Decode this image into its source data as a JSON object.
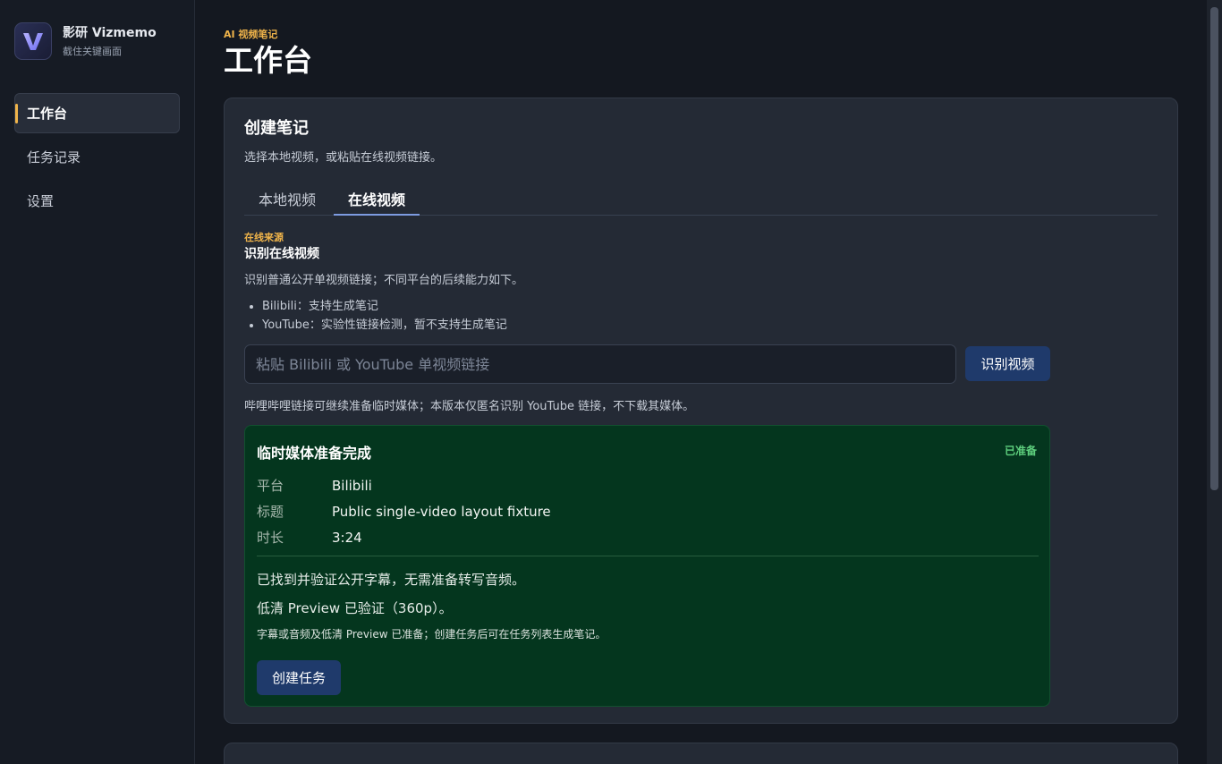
{
  "brand": {
    "name": "影研 Vizmemo",
    "tagline": "截住关键画面",
    "logo_icon": "v-logo-icon"
  },
  "sidebar": {
    "items": [
      {
        "label": "工作台",
        "active": true
      },
      {
        "label": "任务记录",
        "active": false
      },
      {
        "label": "设置",
        "active": false
      }
    ]
  },
  "header": {
    "eyebrow": "AI 视频笔记",
    "title": "工作台"
  },
  "card": {
    "title": "创建笔记",
    "subtitle": "选择本地视频，或粘贴在线视频链接。",
    "tabs": [
      {
        "label": "本地视频",
        "active": false
      },
      {
        "label": "在线视频",
        "active": true
      }
    ]
  },
  "online": {
    "eyebrow": "在线来源",
    "title": "识别在线视频",
    "description": "识别普通公开单视频链接；不同平台的后续能力如下。",
    "platforms": [
      "Bilibili：支持生成笔记",
      "YouTube：实验性链接检测，暂不支持生成笔记"
    ],
    "input_value": "",
    "input_placeholder": "粘贴 Bilibili 或 YouTube 单视频链接",
    "recognize_label": "识别视频",
    "hint": "哔哩哔哩链接可继续准备临时媒体；本版本仅匿名识别 YouTube 链接，不下载其媒体。"
  },
  "result": {
    "title": "临时媒体准备完成",
    "badge": "已准备",
    "meta": [
      {
        "key": "平台",
        "value": "Bilibili"
      },
      {
        "key": "标题",
        "value": "Public single-video layout fixture"
      },
      {
        "key": "时长",
        "value": "3:24"
      }
    ],
    "message1": "已找到并验证公开字幕，无需准备转写音频。",
    "message2": "低清 Preview 已验证（360p）。",
    "message3": "字幕或音频及低清 Preview 已准备；创建任务后可在任务列表生成笔记。",
    "create_label": "创建任务"
  },
  "colors": {
    "accent": "#f0b44a",
    "success_bg": "#04361e",
    "button": "#1f3a6b"
  }
}
